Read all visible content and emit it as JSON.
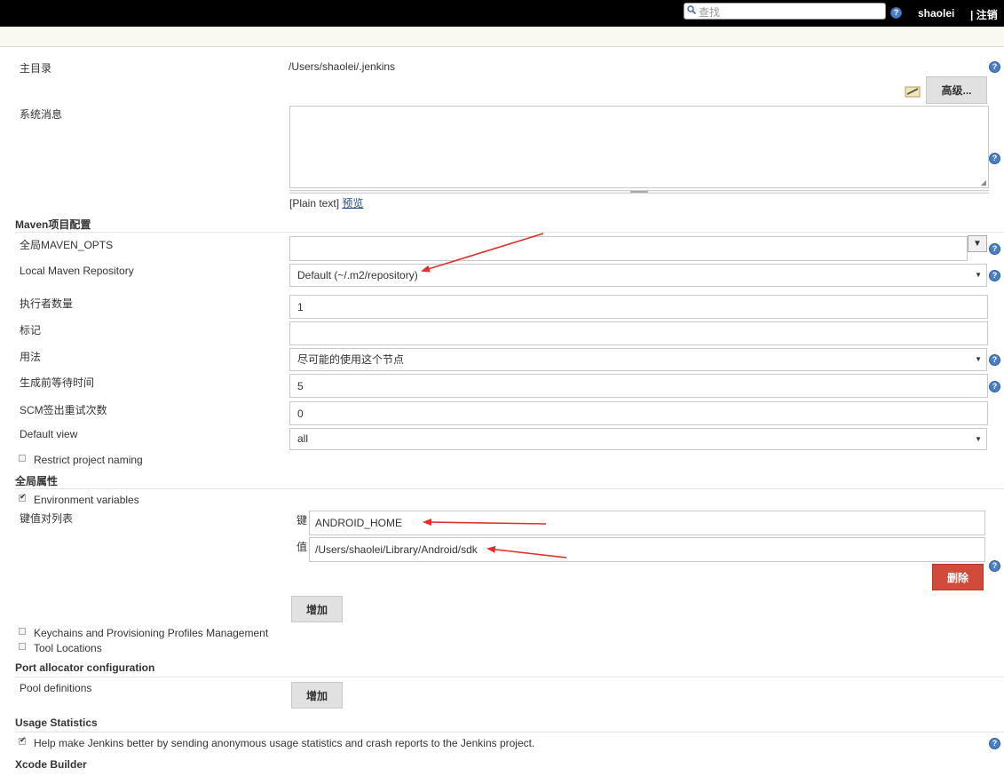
{
  "header": {
    "search_placeholder": "查找",
    "username": "shaolei",
    "logout_label": "| 注销"
  },
  "home": {
    "label": "主目录",
    "path": "/Users/shaolei/.jenkins"
  },
  "advanced_button": "高级...",
  "system_message": {
    "label": "系统消息",
    "value": "",
    "format_label": "[Plain text]",
    "preview_link": "预览"
  },
  "maven": {
    "section_title": "Maven项目配置",
    "opts_label": "全局MAVEN_OPTS",
    "opts_value": "",
    "repo_label": "Local Maven Repository",
    "repo_value": "Default (~/.m2/repository)"
  },
  "executors": {
    "label": "执行者数量",
    "value": "1"
  },
  "labels": {
    "label": "标记",
    "value": ""
  },
  "usage": {
    "label": "用法",
    "value": "尽可能的使用这个节点"
  },
  "quiet_period": {
    "label": "生成前等待时间",
    "value": "5"
  },
  "scm_retry": {
    "label": "SCM签出重试次数",
    "value": "0"
  },
  "default_view": {
    "label": "Default view",
    "value": "all"
  },
  "restrict_naming": {
    "label": "Restrict project naming",
    "checked": false
  },
  "global_props": {
    "section_title": "全局属性",
    "env_vars": {
      "label": "Environment variables",
      "checked": true
    },
    "kv_list_label": "键值对列表",
    "key_label": "键",
    "key_value": "ANDROID_HOME",
    "value_label": "值",
    "value_value": "/Users/shaolei/Library/Android/sdk",
    "delete_button": "删除",
    "add_button": "增加",
    "keychains": {
      "label": "Keychains and Provisioning Profiles Management",
      "checked": false
    },
    "tool_locations": {
      "label": "Tool Locations",
      "checked": false
    }
  },
  "port_allocator": {
    "section_title": "Port allocator configuration",
    "pool_label": "Pool definitions",
    "add_button": "增加"
  },
  "usage_stats": {
    "section_title": "Usage Statistics",
    "help_label": "Help make Jenkins better by sending anonymous usage statistics and crash reports to the Jenkins project.",
    "checked": true
  },
  "xcode": {
    "section_title": "Xcode Builder"
  },
  "colors": {
    "accent_red": "#d24a3a",
    "arrow": "#e0302a",
    "topbar": "#000000"
  }
}
